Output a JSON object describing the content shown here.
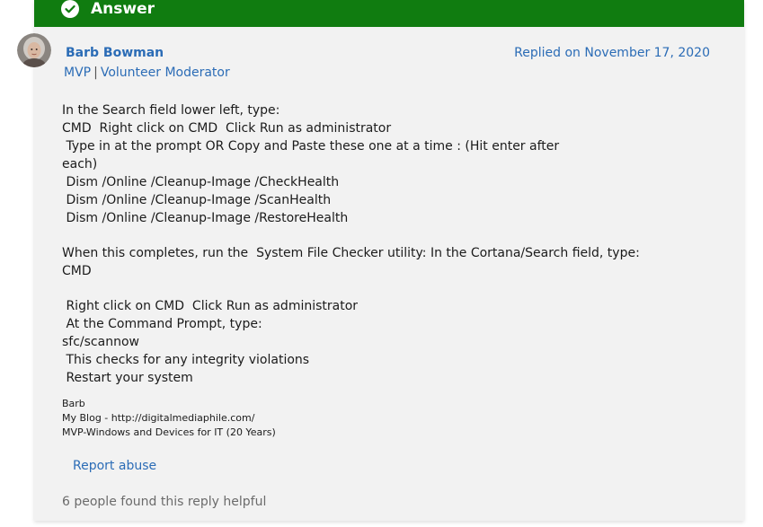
{
  "answer_bar": {
    "label": "Answer",
    "color": "#107c10"
  },
  "author": {
    "name": "Barb Bowman",
    "role_primary": "MVP",
    "role_secondary": "Volunteer Moderator",
    "avatar_icon": "user-avatar-photo"
  },
  "replied_on": "Replied on November 17, 2020",
  "body_lines": [
    "In the Search field lower left, type:",
    "CMD  Right click on CMD  Click Run as administrator",
    " Type in at the prompt OR Copy and Paste these one at a time : (Hit enter after",
    "each)",
    " Dism /Online /Cleanup-Image /CheckHealth",
    " Dism /Online /Cleanup-Image /ScanHealth",
    " Dism /Online /Cleanup-Image /RestoreHealth",
    "",
    "When this completes, run the  System File Checker utility: In the Cortana/Search field, type:",
    "CMD",
    "",
    " Right click on CMD  Click Run as administrator",
    " At the Command Prompt, type:",
    "sfc/scannow",
    " This checks for any integrity violations",
    " Restart your system"
  ],
  "signature": {
    "name": "Barb",
    "blog": "My Blog - http://digitalmediaphile.com/",
    "title": "MVP-Windows and Devices for IT (20 Years)"
  },
  "report_abuse": "Report abuse",
  "helpful_count": "6 people found this reply helpful",
  "colors": {
    "link": "#2b6cb6",
    "card_bg": "#f2f2f2",
    "muted": "#6b6b6b"
  }
}
